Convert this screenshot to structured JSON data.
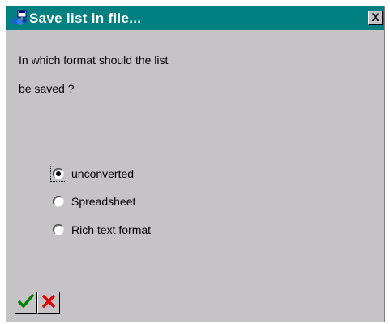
{
  "window": {
    "title": "Save list in file...",
    "icon": "save-list-icon",
    "close_label": "X"
  },
  "prompt": {
    "line1": "In which format should the list",
    "line2": "be saved ?"
  },
  "options": [
    {
      "label": "unconverted",
      "checked": true
    },
    {
      "label": "Spreadsheet",
      "checked": false
    },
    {
      "label": "Rich text format",
      "checked": false
    }
  ],
  "buttons": {
    "ok_icon": "green-checkmark-icon",
    "cancel_icon": "red-x-icon"
  },
  "colors": {
    "titlebar": "#008080",
    "dialog_bg": "#c6c3c6",
    "ok_green": "#008000",
    "cancel_red": "#e00000"
  }
}
